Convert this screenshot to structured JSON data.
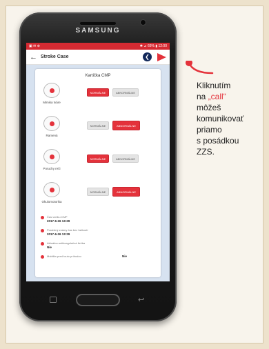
{
  "phone": {
    "brand": "SAMSUNG"
  },
  "statusbar": {
    "left": "▣ ✉ ⊕",
    "right": "✱ ⊿ 66% ▮ 12:00"
  },
  "appbar": {
    "back_icon": "back-arrow-icon",
    "title": "Stroke Case",
    "info_icon": "info-circle-icon",
    "send_icon": "send-icon"
  },
  "card": {
    "title": "Kartička CMP",
    "rows": [
      {
        "label": "Mimika tváre",
        "icon": "face-icon",
        "no": "NORMÁLNE",
        "yes": "ABNORMÁLNE",
        "no_active": true,
        "yes_active": false
      },
      {
        "label": "Ramená",
        "icon": "arm-icon",
        "no": "NORMÁLNE",
        "yes": "ABNORMÁLNE",
        "no_active": false,
        "yes_active": true
      },
      {
        "label": "Poruchy reči",
        "icon": "speech-icon",
        "no": "NORMÁLNE",
        "yes": "ABNORMÁLNE",
        "no_active": true,
        "yes_active": false
      },
      {
        "label": "Okulomotorika",
        "icon": "eye-icon",
        "no": "NORMÁLNE",
        "yes": "ABNORMÁLNE",
        "no_active": false,
        "yes_active": true
      }
    ],
    "info": [
      {
        "label": "Čas vzniku CMP",
        "value": "2017-6-26 13:29"
      },
      {
        "label": "Posledný známy čas bez ťažkostí",
        "value": "2017-6-26 13:29"
      },
      {
        "label": "Aktuálna antikoagulačná liečba",
        "value": "Nie"
      },
      {
        "label": "Mobilita pred touto príhodou",
        "value": "Nie"
      }
    ]
  },
  "annotation": {
    "line1": "Kliknutím",
    "line2_prefix": "na ",
    "line2_call": "„call“",
    "line3": "môžeš",
    "line4": "komunikovať",
    "line5": "priamo",
    "line6": "s posádkou",
    "line7": "ZZS.",
    "accent_color": "#e4323b"
  }
}
